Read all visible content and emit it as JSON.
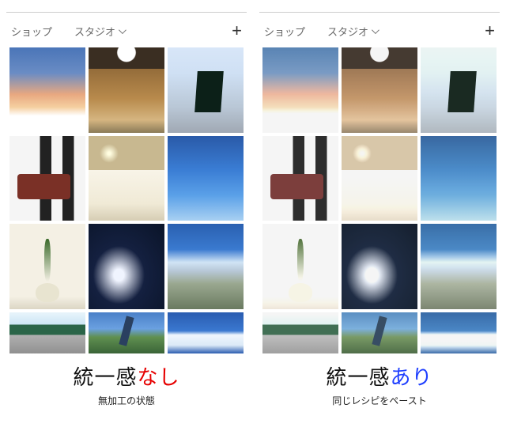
{
  "tabs": {
    "shop": "ショップ",
    "studio": "スタジオ"
  },
  "thumbs": [
    {
      "name": "sunset-field"
    },
    {
      "name": "hallway-corridor"
    },
    {
      "name": "sidewalk-signboard"
    },
    {
      "name": "wooden-desk"
    },
    {
      "name": "hotel-bed"
    },
    {
      "name": "blue-sky"
    },
    {
      "name": "potted-plant"
    },
    {
      "name": "motorcycle-dash"
    },
    {
      "name": "street-blossoms"
    },
    {
      "name": "green-building"
    },
    {
      "name": "crane-sky"
    },
    {
      "name": "sky-cloud"
    }
  ],
  "left": {
    "title_prefix": "統一感",
    "title_suffix": "なし",
    "subtitle": "無加工の状態",
    "suffix_color": "red"
  },
  "right": {
    "title_prefix": "統一感",
    "title_suffix": "あり",
    "subtitle": "同じレシピをペースト",
    "suffix_color": "blue"
  }
}
